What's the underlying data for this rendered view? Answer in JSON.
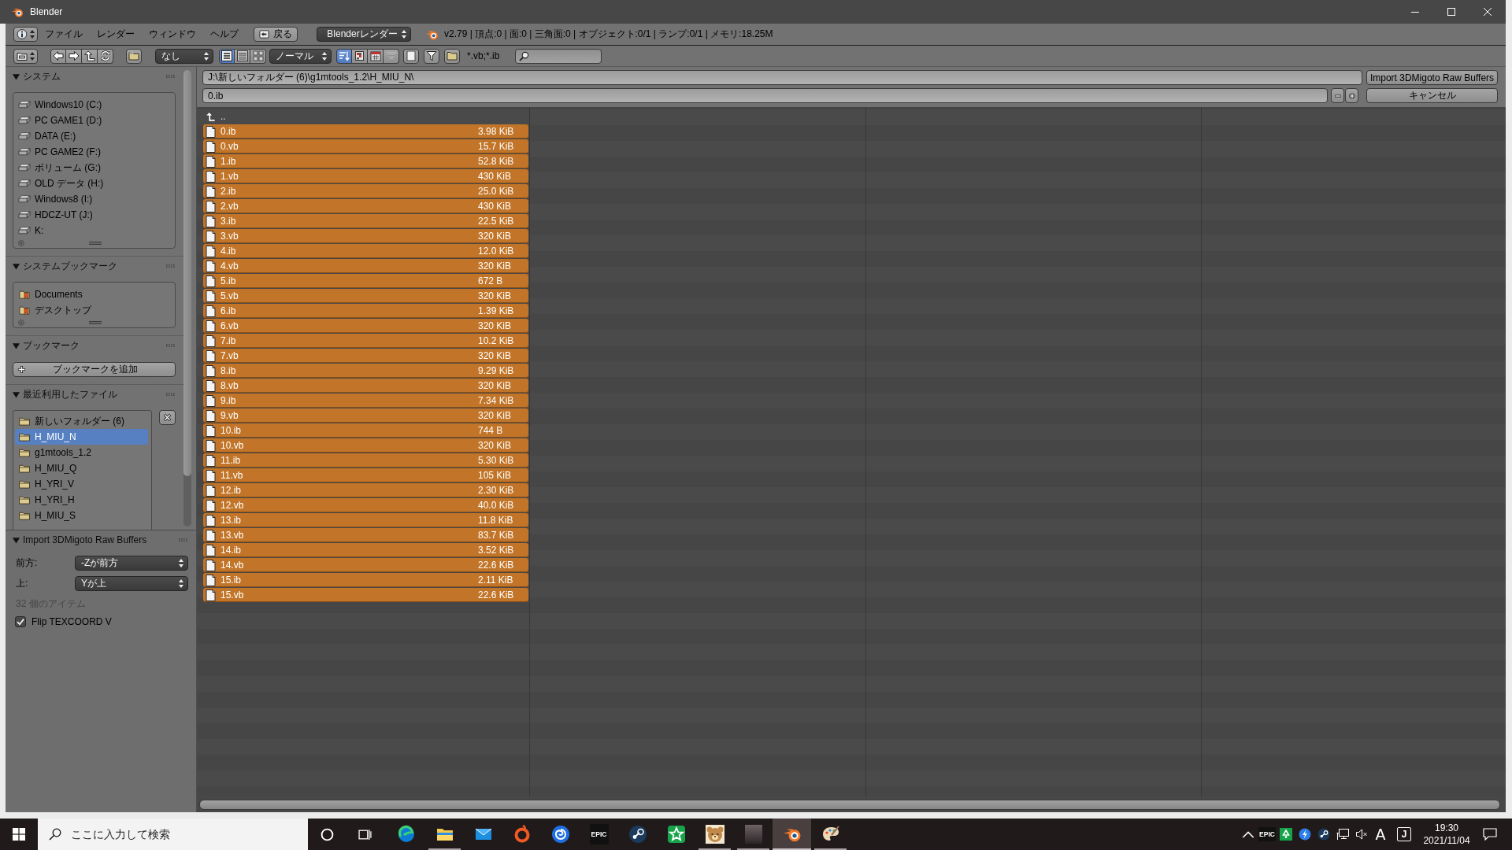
{
  "window": {
    "title": "Blender"
  },
  "info_header": {
    "menus": [
      "ファイル",
      "レンダー",
      "ウィンドウ",
      "ヘルプ"
    ],
    "back_button": "戻る",
    "render_engine": "Blenderレンダー",
    "stats": "v2.79 | 頂点:0 | 面:0 | 三角面:0 | オブジェクト:0/1 | ランプ:0/1 | メモリ:18.25M"
  },
  "file_header": {
    "recursion": "なし",
    "display_modes": [
      {
        "kind": "short",
        "selected": true
      },
      {
        "kind": "long",
        "selected": false
      },
      {
        "kind": "thumbnails",
        "selected": false
      }
    ],
    "display_size": "ノーマル",
    "sort_modes": [
      {
        "kind": "name",
        "selected": true
      },
      {
        "kind": "extension",
        "selected": false
      },
      {
        "kind": "time",
        "selected": false
      },
      {
        "kind": "size",
        "selected": false
      }
    ],
    "filter_text": "*.vb;*.ib"
  },
  "sidebar": {
    "panels": [
      {
        "kind": "volumes",
        "title": "システム",
        "expanded": true,
        "items": [
          "Windows10 (C:)",
          "PC GAME1 (D:)",
          "DATA (E:)",
          "PC GAME2 (F:)",
          "ボリューム (G:)",
          "OLD データ (H:)",
          "Windows8 (I:)",
          "HDCZ-UT (J:)",
          "K:"
        ]
      },
      {
        "kind": "bookmarks",
        "title": "システムブックマーク",
        "expanded": true,
        "items": [
          "Documents",
          "デスクトップ"
        ]
      },
      {
        "kind": "add",
        "title": "ブックマーク",
        "expanded": true,
        "button": "ブックマークを追加"
      },
      {
        "kind": "recent",
        "title": "最近利用したファイル",
        "expanded": true,
        "items": [
          {
            "name": "新しいフォルダー (6)",
            "selected": false
          },
          {
            "name": "H_MIU_N",
            "selected": true
          },
          {
            "name": "g1mtools_1.2",
            "selected": false
          },
          {
            "name": "H_MIU_Q",
            "selected": false
          },
          {
            "name": "H_YRI_V",
            "selected": false
          },
          {
            "name": "H_YRI_H",
            "selected": false
          },
          {
            "name": "H_MIU_S",
            "selected": false
          }
        ]
      }
    ],
    "operator": {
      "title": "Import 3DMigoto Raw Buffers",
      "expanded": true,
      "fields": [
        {
          "label": "前方:",
          "value": "-Zが前方"
        },
        {
          "label": "上:",
          "value": "Yが上"
        }
      ],
      "note": "32 個のアイテム",
      "options": [
        {
          "label": "Flip TEXCOORD V",
          "checked": true
        }
      ]
    }
  },
  "file_browser": {
    "path": "J:\\新しいフォルダー (6)\\g1mtools_1.2\\H_MIU_N\\",
    "filename": "0.ib",
    "execute_button": "Import 3DMigoto Raw Buffers",
    "cancel_button": "キャンセル",
    "parent": "..",
    "files": [
      {
        "name": "0.ib",
        "size": "3.98 KiB",
        "selected": true
      },
      {
        "name": "0.vb",
        "size": "15.7 KiB",
        "selected": true
      },
      {
        "name": "1.ib",
        "size": "52.8 KiB",
        "selected": true
      },
      {
        "name": "1.vb",
        "size": "430 KiB",
        "selected": true
      },
      {
        "name": "2.ib",
        "size": "25.0 KiB",
        "selected": true
      },
      {
        "name": "2.vb",
        "size": "430 KiB",
        "selected": true
      },
      {
        "name": "3.ib",
        "size": "22.5 KiB",
        "selected": true
      },
      {
        "name": "3.vb",
        "size": "320 KiB",
        "selected": true
      },
      {
        "name": "4.ib",
        "size": "12.0 KiB",
        "selected": true
      },
      {
        "name": "4.vb",
        "size": "320 KiB",
        "selected": true
      },
      {
        "name": "5.ib",
        "size": "672 B",
        "selected": true
      },
      {
        "name": "5.vb",
        "size": "320 KiB",
        "selected": true
      },
      {
        "name": "6.ib",
        "size": "1.39 KiB",
        "selected": true
      },
      {
        "name": "6.vb",
        "size": "320 KiB",
        "selected": true
      },
      {
        "name": "7.ib",
        "size": "10.2 KiB",
        "selected": true
      },
      {
        "name": "7.vb",
        "size": "320 KiB",
        "selected": true
      },
      {
        "name": "8.ib",
        "size": "9.29 KiB",
        "selected": true
      },
      {
        "name": "8.vb",
        "size": "320 KiB",
        "selected": true
      },
      {
        "name": "9.ib",
        "size": "7.34 KiB",
        "selected": true
      },
      {
        "name": "9.vb",
        "size": "320 KiB",
        "selected": true
      },
      {
        "name": "10.ib",
        "size": "744 B",
        "selected": true
      },
      {
        "name": "10.vb",
        "size": "320 KiB",
        "selected": true
      },
      {
        "name": "11.ib",
        "size": "5.30 KiB",
        "selected": true
      },
      {
        "name": "11.vb",
        "size": "105 KiB",
        "selected": true
      },
      {
        "name": "12.ib",
        "size": "2.30 KiB",
        "selected": true
      },
      {
        "name": "12.vb",
        "size": "40.0 KiB",
        "selected": true
      },
      {
        "name": "13.ib",
        "size": "11.8 KiB",
        "selected": true
      },
      {
        "name": "13.vb",
        "size": "83.7 KiB",
        "selected": true
      },
      {
        "name": "14.ib",
        "size": "3.52 KiB",
        "selected": true
      },
      {
        "name": "14.vb",
        "size": "22.6 KiB",
        "selected": true
      },
      {
        "name": "15.ib",
        "size": "2.11 KiB",
        "selected": true
      },
      {
        "name": "15.vb",
        "size": "22.6 KiB",
        "selected": true
      }
    ]
  },
  "taskbar": {
    "search": {
      "placeholder": "ここに入力して検索"
    },
    "apps": [
      {
        "kind": "browser",
        "running": false,
        "active": false
      },
      {
        "kind": "files",
        "running": true,
        "active": false
      },
      {
        "kind": "mail",
        "running": false,
        "active": false
      },
      {
        "kind": "ring",
        "running": false,
        "active": false
      },
      {
        "kind": "swirl",
        "running": false,
        "active": false
      },
      {
        "kind": "wordmark",
        "text": "EPIC",
        "running": false,
        "active": false
      },
      {
        "kind": "steam",
        "running": false,
        "active": false
      },
      {
        "kind": "star",
        "running": false,
        "active": false
      },
      {
        "kind": "bear",
        "running": true,
        "active": false
      },
      {
        "kind": "photo",
        "running": true,
        "active": false
      },
      {
        "kind": "blender",
        "running": true,
        "active": true
      },
      {
        "kind": "paint",
        "running": true,
        "active": false
      }
    ],
    "tray": [
      {
        "kind": "chevron"
      },
      {
        "kind": "wordmark",
        "text": "EPIC"
      },
      {
        "kind": "recycle"
      },
      {
        "kind": "bolt"
      },
      {
        "kind": "steam"
      },
      {
        "kind": "network"
      },
      {
        "kind": "muted"
      }
    ],
    "ime_mode": "A",
    "ime_pad": "J",
    "time": "19:30",
    "date": "2021/11/04"
  }
}
